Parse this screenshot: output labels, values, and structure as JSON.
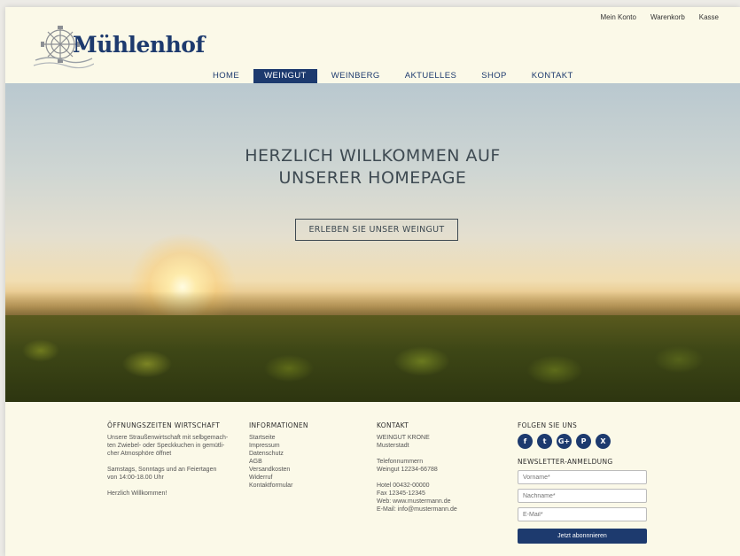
{
  "topbar": {
    "account": "Mein Konto",
    "cart": "Warenkorb",
    "checkout": "Kasse"
  },
  "brand": {
    "logo_text": "Mühlenhof",
    "color": "#1d3a6e"
  },
  "nav": {
    "items": [
      {
        "label": "HOME",
        "active": false
      },
      {
        "label": "WEINGUT",
        "active": true
      },
      {
        "label": "WEINBERG",
        "active": false
      },
      {
        "label": "AKTUELLES",
        "active": false
      },
      {
        "label": "SHOP",
        "active": false
      },
      {
        "label": "KONTAKT",
        "active": false
      }
    ]
  },
  "hero": {
    "title_line1": "HERZLICH WILLKOMMEN AUF",
    "title_line2": "UNSERER HOMEPAGE",
    "cta": "ERLEBEN SIE UNSER WEINGUT"
  },
  "footer": {
    "hours": {
      "heading": "ÖFFNUNGSZEITEN WIRTSCHAFT",
      "lines": [
        "Unsere Straußenwirtschaft mit selbgemach-",
        "ten Zwiebel- oder Speckkuchen in gemütli-",
        "cher Atmosphöre öffnet"
      ],
      "schedule": [
        "Samstags, Sonntags und an Feiertagen",
        "von 14:00-18.00 Uhr"
      ],
      "greeting": "Herzlich Willkommen!"
    },
    "info": {
      "heading": "INFORMATIONEN",
      "links": [
        "Startseite",
        "Impressum",
        "Datenschutz",
        "AGB",
        "Versandkosten",
        "Widerruf",
        "Kontaktformular"
      ]
    },
    "contact": {
      "heading": "KONTAKT",
      "name": "WEINGUT KRONE",
      "city": "Musterstadt",
      "phone_label": "Telefonnummern",
      "phone": "Weingut 12234-66788",
      "hotel": "Hotel 00432-00000",
      "fax": "Fax 12345-12345",
      "web": "Web: www.mustermann.de",
      "email": "E-Mail: info@mustermann.de"
    },
    "social": {
      "heading": "FOLGEN SIE UNS",
      "icons": [
        "f",
        "t",
        "G+",
        "P",
        "X"
      ]
    },
    "newsletter": {
      "heading": "NEWSLETTER-ANMELDUNG",
      "first_name": "Vorname*",
      "last_name": "Nachname*",
      "email": "E-Mail*",
      "button": "Jetzt abonnnieren"
    }
  }
}
